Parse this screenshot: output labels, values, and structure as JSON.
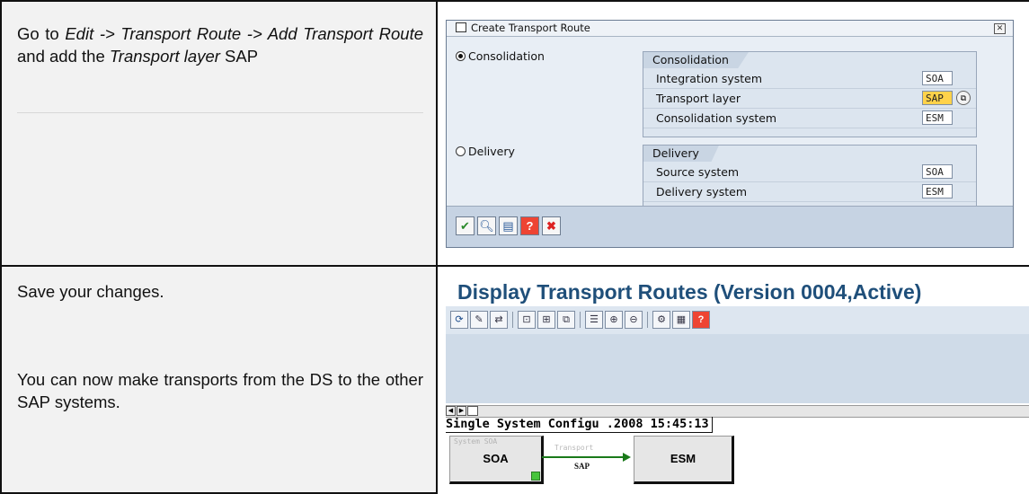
{
  "row1": {
    "instruction_parts": [
      {
        "text": "Go to ",
        "italic": false
      },
      {
        "text": "Edit -> Transport Route -> Add Transport Route",
        "italic": true
      },
      {
        "text": " and add the ",
        "italic": false
      },
      {
        "text": "Transport layer",
        "italic": true
      },
      {
        "text": " SAP",
        "italic": false
      }
    ],
    "dialog": {
      "title": "Create Transport Route",
      "consolidation_radio": "Consolidation",
      "delivery_radio": "Delivery",
      "selected": "Consolidation",
      "consolidation_group": {
        "tab": "Consolidation",
        "rows": [
          {
            "label": "Integration system",
            "value": "SOA"
          },
          {
            "label": "Transport layer",
            "value": "SAP"
          },
          {
            "label": "Consolidation system",
            "value": "ESM"
          }
        ]
      },
      "delivery_group": {
        "tab": "Delivery",
        "rows": [
          {
            "label": "Source system",
            "value": "SOA"
          },
          {
            "label": "Delivery system",
            "value": "ESM"
          }
        ]
      },
      "footer_buttons": [
        "checkmark-icon",
        "search-icon",
        "copy-icon",
        "help-icon",
        "cancel-icon"
      ]
    }
  },
  "row2": {
    "instruction_1": "Save your changes.",
    "instruction_2": "You can now make transports from the DS to the other SAP systems.",
    "screen": {
      "title": "Display Transport Routes (Version 0004,Active)",
      "header_line": "Single System Configu .2008  15:45:13",
      "nodes": [
        {
          "caption": "System  SOA",
          "name": "SOA"
        },
        {
          "caption": "",
          "name": "ESM"
        }
      ],
      "route_caption": "Transport",
      "route_label": "SAP"
    }
  },
  "colors": {
    "title_blue": "#1f4f7a",
    "highlight_yellow": "#ffd24a",
    "route_green": "#1a7a1a"
  }
}
